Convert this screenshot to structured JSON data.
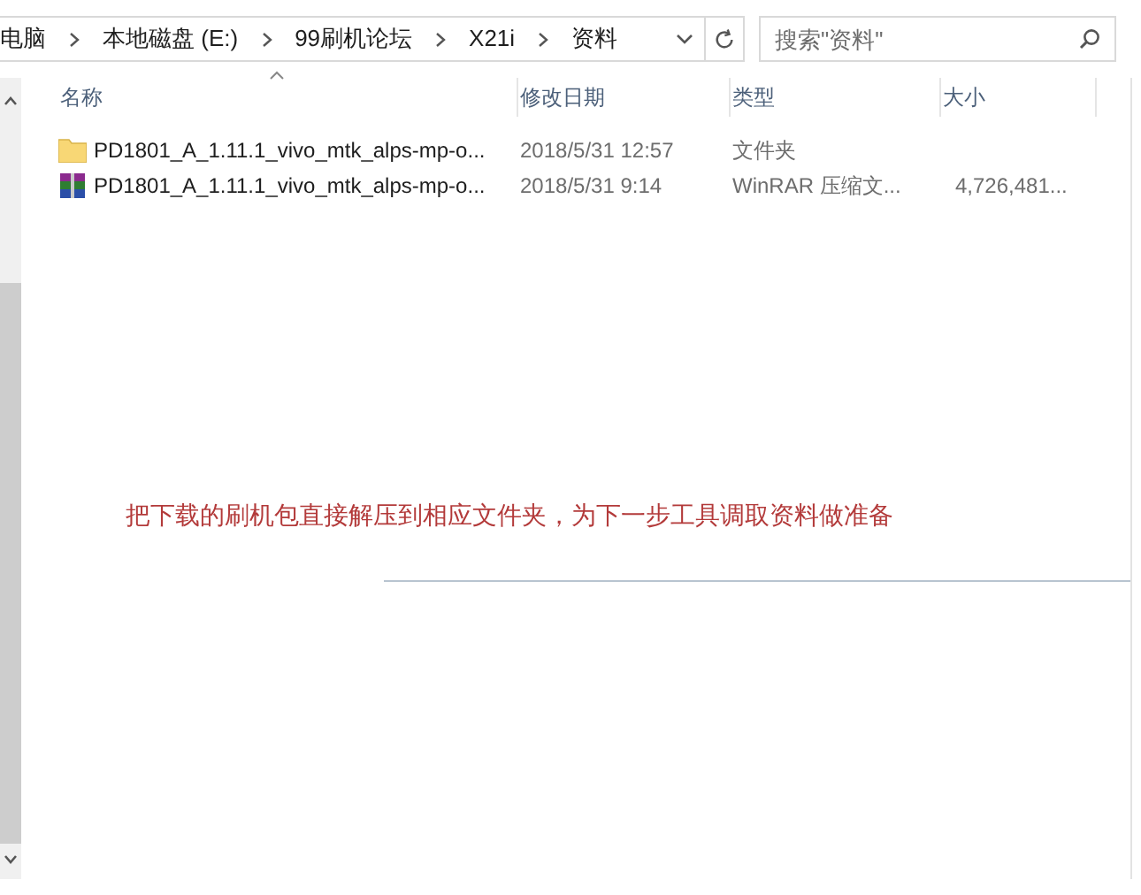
{
  "address_bar": {
    "breadcrumbs": [
      "电脑",
      "本地磁盘 (E:)",
      "99刷机论坛",
      "X21i",
      "资料"
    ]
  },
  "search": {
    "placeholder": "搜索\"资料\""
  },
  "columns": [
    "名称",
    "修改日期",
    "类型",
    "大小"
  ],
  "files": [
    {
      "kind": "folder",
      "name": "PD1801_A_1.11.1_vivo_mtk_alps-mp-o...",
      "modified": "2018/5/31 12:57",
      "type": "文件夹"
    },
    {
      "kind": "archive",
      "name": "PD1801_A_1.11.1_vivo_mtk_alps-mp-o...",
      "modified": "2018/5/31 9:14",
      "type": "WinRAR 压缩文...",
      "size": "4,726,481..."
    }
  ],
  "annotation": "把下载的刷机包直接解压到相应文件夹，为下一步工具调取资料做准备"
}
